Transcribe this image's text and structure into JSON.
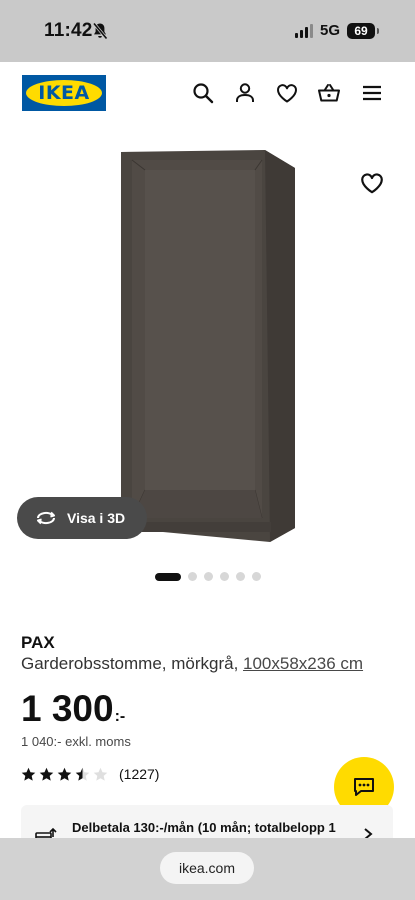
{
  "status": {
    "time": "11:42",
    "network": "5G",
    "battery": "69"
  },
  "header": {
    "logo_text": "IKEA"
  },
  "product": {
    "visa3d_label": "Visa i 3D",
    "brand": "PAX",
    "description": "Garderobsstomme, mörkgrå, ",
    "dimensions": "100x58x236 cm",
    "price": "1 300",
    "price_suffix": ":-",
    "price_ex_vat": "1 040:- exkl. moms",
    "rating_value": 3.5,
    "rating_max": 5,
    "rating_count": "(1227)",
    "carousel_count": 6,
    "carousel_active": 0,
    "color": "#4a4540"
  },
  "installment": {
    "text": "Delbetala 130:-/mån (10 mån; totalbelopp 1"
  },
  "browser": {
    "url": "ikea.com"
  },
  "colors": {
    "ikea_blue": "#0058a3",
    "ikea_yellow": "#ffdb00"
  }
}
